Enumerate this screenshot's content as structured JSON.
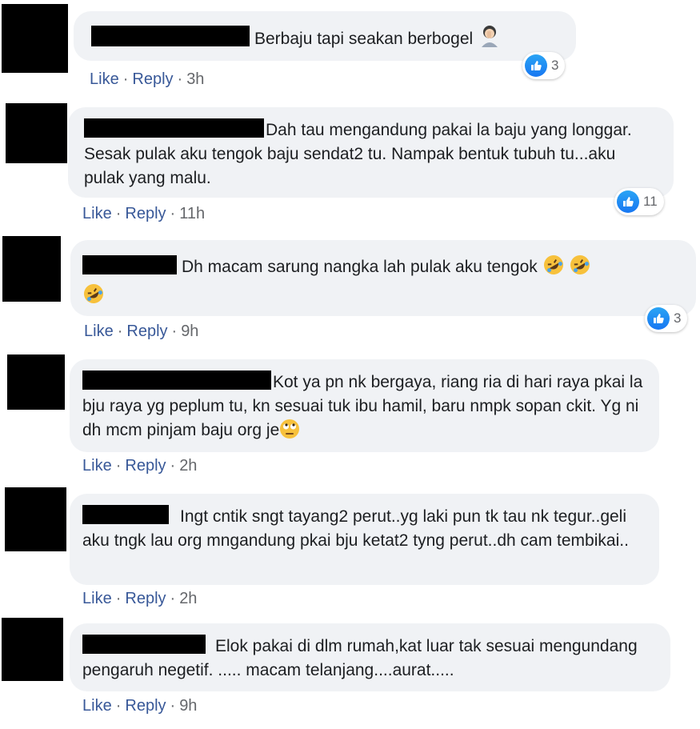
{
  "comments": [
    {
      "text": "Berbaju tapi seakan berbogel",
      "emoji": "woman-facepalming",
      "actions": {
        "like": "Like",
        "reply": "Reply",
        "time": "3h"
      },
      "reactions": {
        "icon": "like-icon",
        "count": "3"
      }
    },
    {
      "text": "Dah tau mengandung pakai la baju yang longgar. Sesak pulak aku tengok baju sendat2 tu. Nampak bentuk tubuh tu...aku pulak yang malu.",
      "actions": {
        "like": "Like",
        "reply": "Reply",
        "time": "11h"
      },
      "reactions": {
        "icon": "like-icon",
        "count": "11"
      }
    },
    {
      "text": "Dh macam sarung nangka lah pulak aku tengok",
      "emoji": "rolling-on-floor-laughing x3",
      "actions": {
        "like": "Like",
        "reply": "Reply",
        "time": "9h"
      },
      "reactions": {
        "icon": "like-icon",
        "count": "3"
      }
    },
    {
      "text": "Kot ya pn nk bergaya, riang ria di hari raya pkai la bju raya yg peplum tu, kn sesuai tuk ibu hamil, baru nmpk sopan ckit. Yg ni dh mcm pinjam baju org je",
      "emoji": "face-with-rolling-eyes",
      "actions": {
        "like": "Like",
        "reply": "Reply",
        "time": "2h"
      }
    },
    {
      "text": "Ingt cntik sngt tayang2 perut..yg laki pun tk tau nk tegur..geli aku tngk lau org mngandung pkai bju ketat2 tyng perut..dh cam tembikai..",
      "actions": {
        "like": "Like",
        "reply": "Reply",
        "time": "2h"
      }
    },
    {
      "text": "Elok pakai di dlm rumah,kat luar tak sesuai mengundang pengaruh negetif. ..... macam telanjang....aurat.....",
      "actions": {
        "like": "Like",
        "reply": "Reply",
        "time": "9h"
      }
    }
  ],
  "separator": "·",
  "colors": {
    "bubble": "#f0f2f5",
    "link": "#385898",
    "meta": "#65676b",
    "like_blue": "#1877f2",
    "redaction": "#000000"
  }
}
